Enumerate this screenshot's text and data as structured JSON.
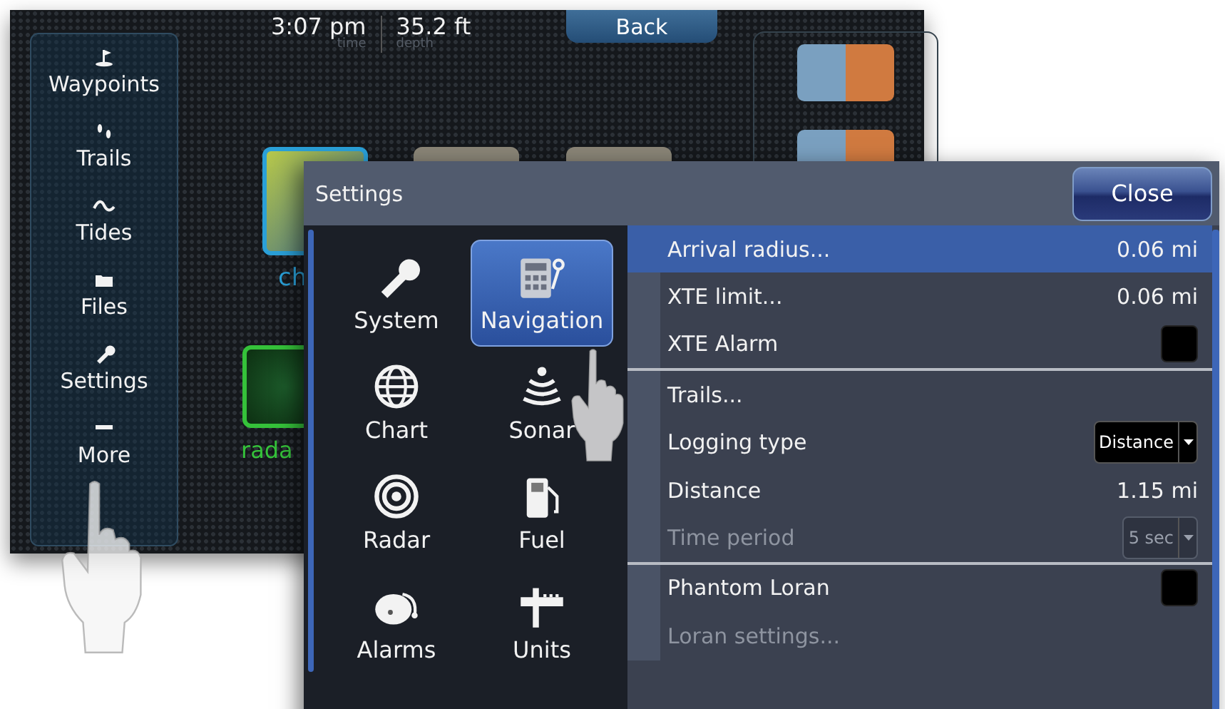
{
  "status_bar": {
    "time": "3:07 pm",
    "time_label": "time",
    "depth": "35.2 ft",
    "depth_label": "depth"
  },
  "back_button": {
    "label": "Back"
  },
  "sidebar": {
    "items": [
      {
        "label": "Waypoints",
        "kind": "flag"
      },
      {
        "label": "Trails",
        "kind": "steps"
      },
      {
        "label": "Tides",
        "kind": "wave"
      },
      {
        "label": "Files",
        "kind": "folder"
      },
      {
        "label": "Settings",
        "kind": "wrench"
      },
      {
        "label": "More",
        "kind": "dash"
      }
    ]
  },
  "tiles": [
    {
      "label": "ch",
      "kind": "chart"
    },
    {
      "label": "rada",
      "kind": "radar"
    }
  ],
  "dialog": {
    "title": "Settings",
    "close_button": "Close",
    "categories": [
      {
        "label": "System",
        "kind": "wrench",
        "selected": false
      },
      {
        "label": "Navigation",
        "kind": "calculator",
        "selected": true
      },
      {
        "label": "Chart",
        "kind": "globe",
        "selected": false
      },
      {
        "label": "Sonar",
        "kind": "sonar",
        "selected": false
      },
      {
        "label": "Radar",
        "kind": "radar",
        "selected": false
      },
      {
        "label": "Fuel",
        "kind": "fuel",
        "selected": false
      },
      {
        "label": "Alarms",
        "kind": "bell",
        "selected": false
      },
      {
        "label": "Units",
        "kind": "ruler",
        "selected": false
      }
    ],
    "settings": [
      {
        "kind": "value",
        "label": "Arrival radius...",
        "value": "0.06 mi",
        "selected": true,
        "disabled": false
      },
      {
        "kind": "value",
        "label": "XTE limit...",
        "value": "0.06 mi",
        "selected": false,
        "disabled": false
      },
      {
        "kind": "checkbox",
        "label": "XTE Alarm",
        "checked": false,
        "selected": false,
        "disabled": false
      },
      {
        "kind": "divider"
      },
      {
        "kind": "link",
        "label": "Trails...",
        "selected": false,
        "disabled": false
      },
      {
        "kind": "dropdown",
        "label": "Logging type",
        "value": "Distance",
        "selected": false,
        "disabled": false
      },
      {
        "kind": "value",
        "label": "Distance",
        "value": "1.15 mi",
        "selected": false,
        "disabled": false
      },
      {
        "kind": "dropdown",
        "label": "Time period",
        "value": "5 sec",
        "selected": false,
        "disabled": true
      },
      {
        "kind": "divider"
      },
      {
        "kind": "checkbox",
        "label": "Phantom Loran",
        "checked": false,
        "selected": false,
        "disabled": false
      },
      {
        "kind": "link",
        "label": "Loran settings...",
        "selected": false,
        "disabled": true
      }
    ]
  }
}
